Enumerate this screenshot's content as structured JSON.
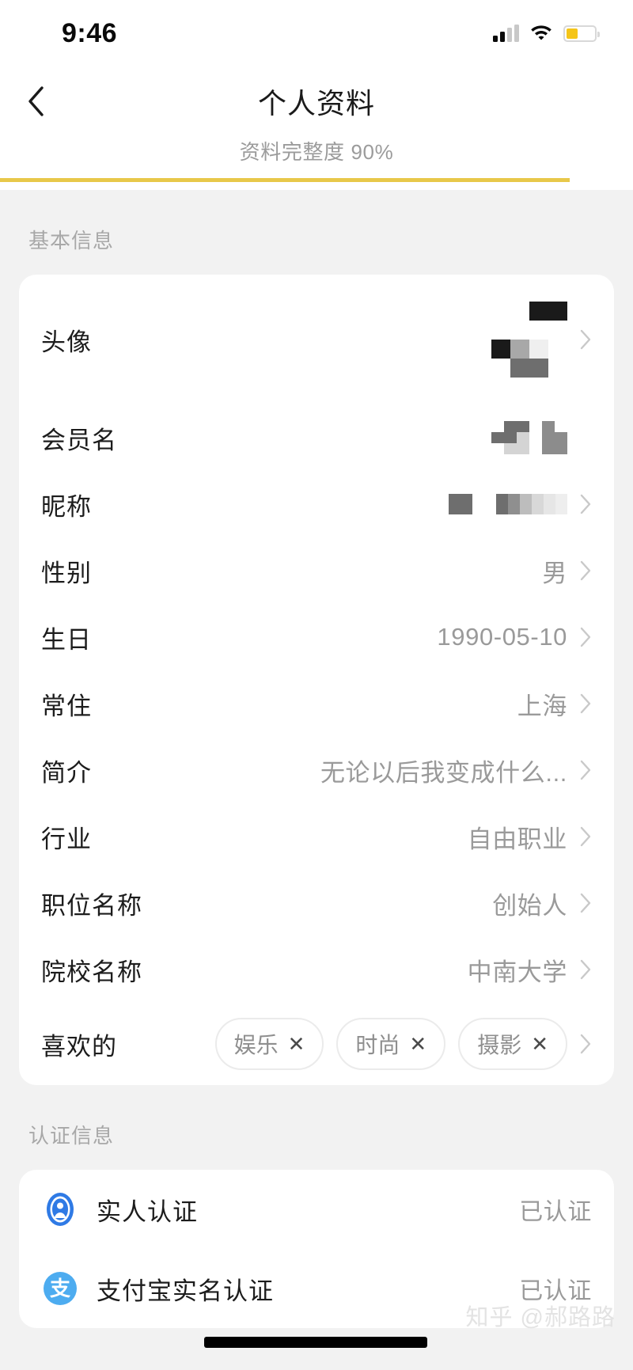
{
  "status_bar": {
    "time": "9:46",
    "signal_icon": "cellular-signal-icon",
    "wifi_icon": "wifi-icon",
    "battery_icon": "battery-icon",
    "battery_color": "#f5c518"
  },
  "nav": {
    "back_icon": "chevron-left-icon",
    "title": "个人资料"
  },
  "completeness": {
    "label": "资料完整度 90%",
    "percent": 90,
    "bar_color": "#e8c84a"
  },
  "basic_section": {
    "title": "基本信息",
    "rows": [
      {
        "label": "头像",
        "value": "",
        "redacted": true,
        "chevron": true
      },
      {
        "label": "会员名",
        "value": "",
        "redacted": true,
        "chevron": false
      },
      {
        "label": "昵称",
        "value": "",
        "redacted": true,
        "chevron": true
      },
      {
        "label": "性别",
        "value": "男",
        "redacted": false,
        "chevron": true
      },
      {
        "label": "生日",
        "value": "1990-05-10",
        "redacted": false,
        "chevron": true
      },
      {
        "label": "常住",
        "value": "上海",
        "redacted": false,
        "chevron": true
      },
      {
        "label": "简介",
        "value": "无论以后我变成什么...",
        "redacted": false,
        "chevron": true
      },
      {
        "label": "行业",
        "value": "自由职业",
        "redacted": false,
        "chevron": true
      },
      {
        "label": "职位名称",
        "value": "创始人",
        "redacted": false,
        "chevron": true
      },
      {
        "label": "院校名称",
        "value": "中南大学",
        "redacted": false,
        "chevron": true
      }
    ],
    "interests_row": {
      "label": "喜欢的",
      "tags": [
        {
          "text": "娱乐",
          "remove": "✕"
        },
        {
          "text": "时尚",
          "remove": "✕"
        },
        {
          "text": "摄影",
          "remove": "✕"
        }
      ],
      "chevron": true
    }
  },
  "verification_section": {
    "title": "认证信息",
    "rows": [
      {
        "icon": "real-person-badge-icon",
        "icon_color": "#2f7ae5",
        "label": "实人认证",
        "status": "已认证"
      },
      {
        "icon": "alipay-icon",
        "icon_color": "#4dacf0",
        "icon_glyph": "支",
        "label": "支付宝实名认证",
        "status": "已认证"
      }
    ]
  },
  "watermark": {
    "text": "知乎 @郝路路"
  }
}
